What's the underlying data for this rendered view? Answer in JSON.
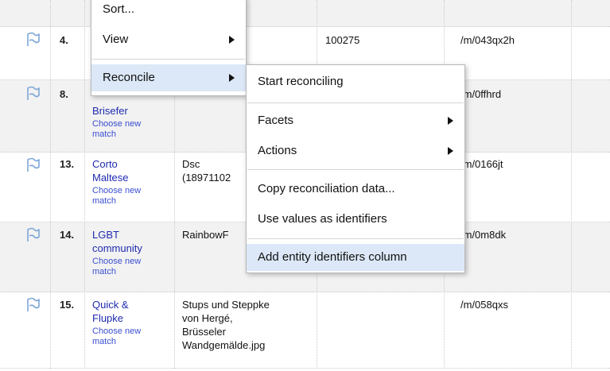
{
  "rows": [
    {
      "num": "4.",
      "name_lines": [],
      "choose": "",
      "desc": [],
      "id_num": "100275",
      "mid": "/m/043qx2h"
    },
    {
      "num": "8.",
      "name_lines": [
        "Brisefer"
      ],
      "choose": "Choose new match",
      "desc": [],
      "id_num": "",
      "mid": "/m/0ffhrd"
    },
    {
      "num": "13.",
      "name_lines": [
        "Corto",
        "Maltese"
      ],
      "choose": "Choose new match",
      "desc": [
        "Dsc",
        "(18971102"
      ],
      "id_num": "",
      "mid": "/m/0166jt"
    },
    {
      "num": "14.",
      "name_lines": [
        "LGBT",
        "community"
      ],
      "choose": "Choose new match",
      "desc": [
        "RainbowF"
      ],
      "id_num": "",
      "mid": "/m/0m8dk"
    },
    {
      "num": "15.",
      "name_lines": [
        "Quick &",
        "Flupke"
      ],
      "choose": "Choose new match",
      "desc": [
        "Stups und Steppke",
        "von Hergé,",
        "Brüsseler",
        "Wandgemälde.jpg"
      ],
      "id_num": "",
      "mid": "/m/058qxs"
    }
  ],
  "menu": {
    "sort_label": "Sort...",
    "view_label": "View",
    "reconcile_label": "Reconcile"
  },
  "submenu": {
    "start": "Start reconciling",
    "facets": "Facets",
    "actions": "Actions",
    "copy": "Copy reconciliation data...",
    "use_values": "Use values as identifiers",
    "add_entity": "Add entity identifiers column"
  },
  "icons": {
    "flag": "flag-icon",
    "submenu_arrow": "chevron-right-icon"
  },
  "colors": {
    "highlight": "#dce8f7",
    "link": "#1f2bb0",
    "row_shade": "#f2f2f2"
  }
}
